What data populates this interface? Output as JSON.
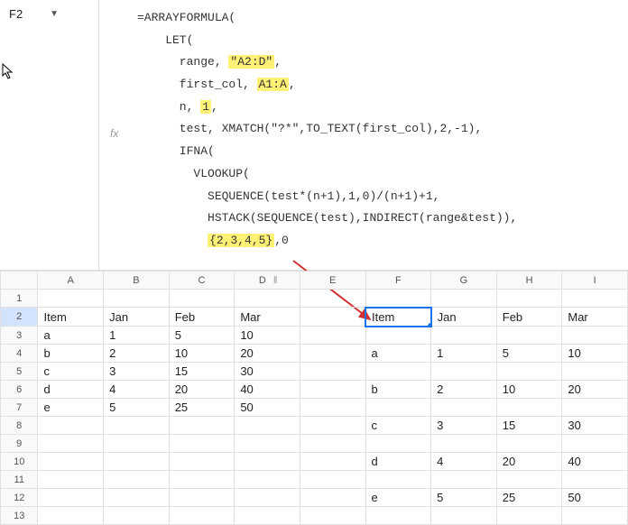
{
  "name_box": "F2",
  "formula": {
    "l0": "=ARRAYFORMULA(",
    "l1": "    LET(",
    "l2_a": "      range, ",
    "l2_hl": "\"A2:D\"",
    "l2_b": ",",
    "l3_a": "      first_col, ",
    "l3_hl": "A1:A",
    "l3_b": ",",
    "l4_a": "      n, ",
    "l4_hl": "1",
    "l4_b": ",",
    "l5": "      test, XMATCH(\"?*\",TO_TEXT(first_col),2,-1),",
    "l6": "      IFNA(",
    "l7": "        VLOOKUP(",
    "l8": "          SEQUENCE(test*(n+1),1,0)/(n+1)+1,",
    "l9": "          HSTACK(SEQUENCE(test),INDIRECT(range&test)),",
    "l10_a": "          ",
    "l10_hl": "{2,3,4,5}",
    "l10_b": ",0"
  },
  "columns": [
    "A",
    "B",
    "C",
    "D",
    "E",
    "F",
    "G",
    "H",
    "I"
  ],
  "rows": [
    {
      "n": "1",
      "cells": [
        "",
        "",
        "",
        "",
        "",
        "",
        "",
        "",
        ""
      ]
    },
    {
      "n": "2",
      "cells": [
        "Item",
        "Jan",
        "Feb",
        "Mar",
        "",
        "Item",
        "Jan",
        "Feb",
        "Mar"
      ],
      "active": true
    },
    {
      "n": "3",
      "cells": [
        "a",
        "1",
        "5",
        "10",
        "",
        "",
        "",
        "",
        ""
      ],
      "nums": [
        false,
        true,
        true,
        true,
        false,
        false,
        false,
        false,
        false
      ]
    },
    {
      "n": "4",
      "cells": [
        "b",
        "2",
        "10",
        "20",
        "",
        "a",
        "1",
        "5",
        "10"
      ],
      "nums": [
        false,
        true,
        true,
        true,
        false,
        false,
        true,
        true,
        true
      ]
    },
    {
      "n": "5",
      "cells": [
        "c",
        "3",
        "15",
        "30",
        "",
        "",
        "",
        "",
        ""
      ],
      "nums": [
        false,
        true,
        true,
        true,
        false,
        false,
        false,
        false,
        false
      ]
    },
    {
      "n": "6",
      "cells": [
        "d",
        "4",
        "20",
        "40",
        "",
        "b",
        "2",
        "10",
        "20"
      ],
      "nums": [
        false,
        true,
        true,
        true,
        false,
        false,
        true,
        true,
        true
      ]
    },
    {
      "n": "7",
      "cells": [
        "e",
        "5",
        "25",
        "50",
        "",
        "",
        "",
        "",
        ""
      ],
      "nums": [
        false,
        true,
        true,
        true,
        false,
        false,
        false,
        false,
        false
      ]
    },
    {
      "n": "8",
      "cells": [
        "",
        "",
        "",
        "",
        "",
        "c",
        "3",
        "15",
        "30"
      ],
      "nums": [
        false,
        false,
        false,
        false,
        false,
        false,
        true,
        true,
        true
      ]
    },
    {
      "n": "9",
      "cells": [
        "",
        "",
        "",
        "",
        "",
        "",
        "",
        "",
        ""
      ]
    },
    {
      "n": "10",
      "cells": [
        "",
        "",
        "",
        "",
        "",
        "d",
        "4",
        "20",
        "40"
      ],
      "nums": [
        false,
        false,
        false,
        false,
        false,
        false,
        true,
        true,
        true
      ]
    },
    {
      "n": "11",
      "cells": [
        "",
        "",
        "",
        "",
        "",
        "",
        "",
        "",
        ""
      ]
    },
    {
      "n": "12",
      "cells": [
        "",
        "",
        "",
        "",
        "",
        "e",
        "5",
        "25",
        "50"
      ],
      "nums": [
        false,
        false,
        false,
        false,
        false,
        false,
        true,
        true,
        true
      ]
    },
    {
      "n": "13",
      "cells": [
        "",
        "",
        "",
        "",
        "",
        "",
        "",
        "",
        ""
      ]
    }
  ],
  "fx_label": "fx",
  "active_cell": {
    "row": 1,
    "col": 5
  },
  "chart_data": {
    "type": "table",
    "title": "Spreadsheet data with ARRAYFORMULA expansion",
    "source_table": {
      "headers": [
        "Item",
        "Jan",
        "Feb",
        "Mar"
      ],
      "rows": [
        [
          "a",
          1,
          5,
          10
        ],
        [
          "b",
          2,
          10,
          20
        ],
        [
          "c",
          3,
          15,
          30
        ],
        [
          "d",
          4,
          20,
          40
        ],
        [
          "e",
          5,
          25,
          50
        ]
      ]
    },
    "result_table": {
      "headers": [
        "Item",
        "Jan",
        "Feb",
        "Mar"
      ],
      "rows": [
        [
          "a",
          1,
          5,
          10
        ],
        [
          "b",
          2,
          10,
          20
        ],
        [
          "c",
          3,
          15,
          30
        ],
        [
          "d",
          4,
          20,
          40
        ],
        [
          "e",
          5,
          25,
          50
        ]
      ],
      "blank_row_between": true
    }
  }
}
